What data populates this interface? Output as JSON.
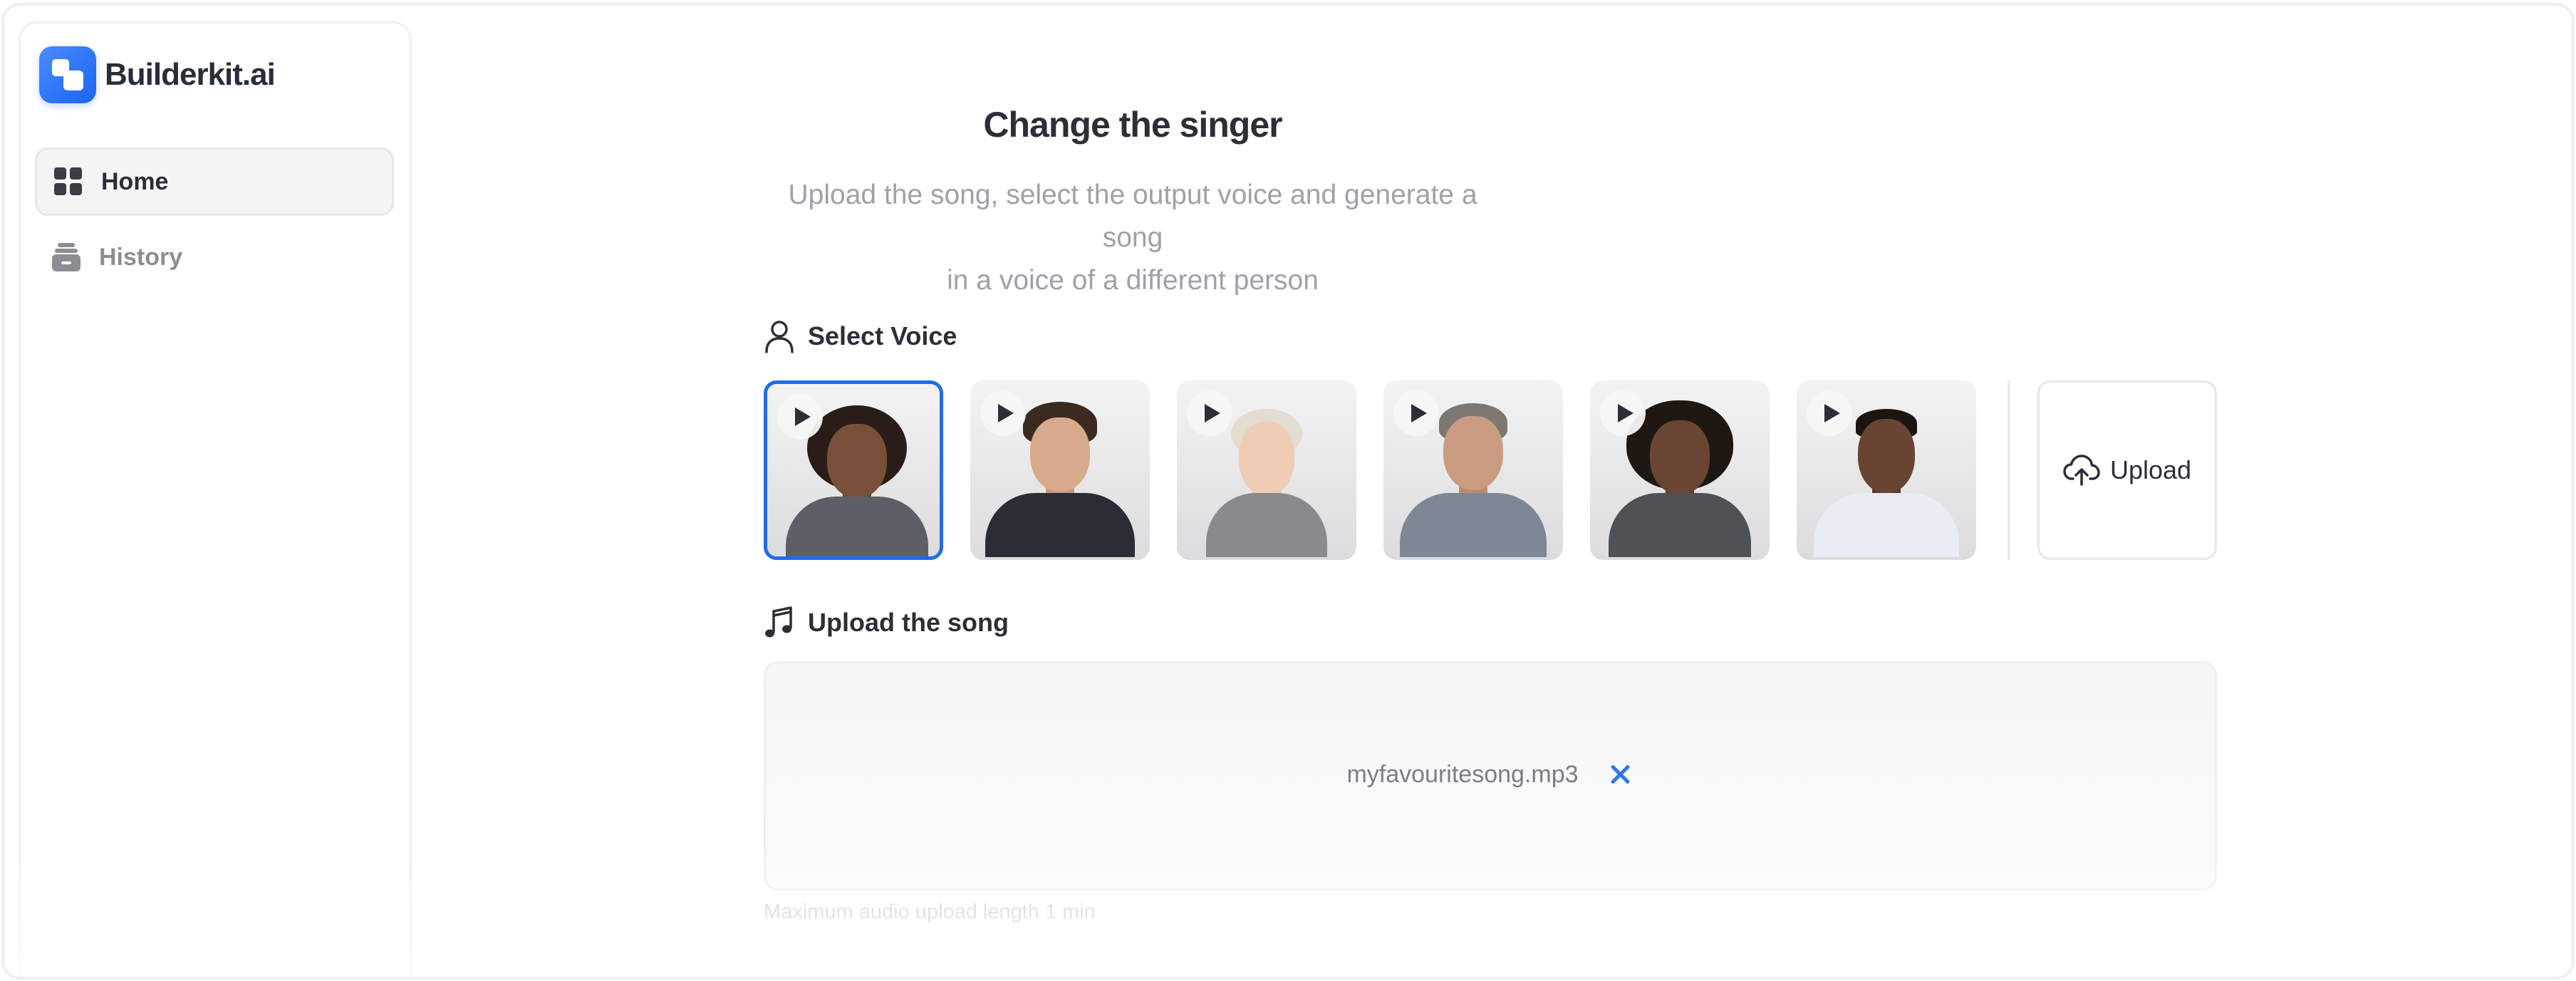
{
  "sidebar": {
    "brand": "Builderkit.ai",
    "items": [
      {
        "label": "Home",
        "icon": "grid-icon",
        "active": true
      },
      {
        "label": "History",
        "icon": "archive-icon",
        "active": false
      }
    ]
  },
  "main": {
    "title": "Change the singer",
    "subtitle_line1": "Upload the song, select the output voice and generate a song",
    "subtitle_line2": "in a voice of a different person",
    "select_voice": {
      "label": "Select Voice",
      "voices": [
        {
          "name": "voice-1",
          "selected": true
        },
        {
          "name": "voice-2",
          "selected": false
        },
        {
          "name": "voice-3",
          "selected": false
        },
        {
          "name": "voice-4",
          "selected": false
        },
        {
          "name": "voice-5",
          "selected": false
        },
        {
          "name": "voice-6",
          "selected": false
        }
      ],
      "upload_label": "Upload"
    },
    "upload_song": {
      "label": "Upload the song",
      "file_name": "myfavouritesong.mp3",
      "hint": "Maximum audio upload length 1 min"
    }
  },
  "colors": {
    "accent": "#1f6cf0",
    "brand_gradient_start": "#4a8cff",
    "brand_gradient_end": "#1a64f5",
    "muted_text": "#9fa1a6"
  }
}
